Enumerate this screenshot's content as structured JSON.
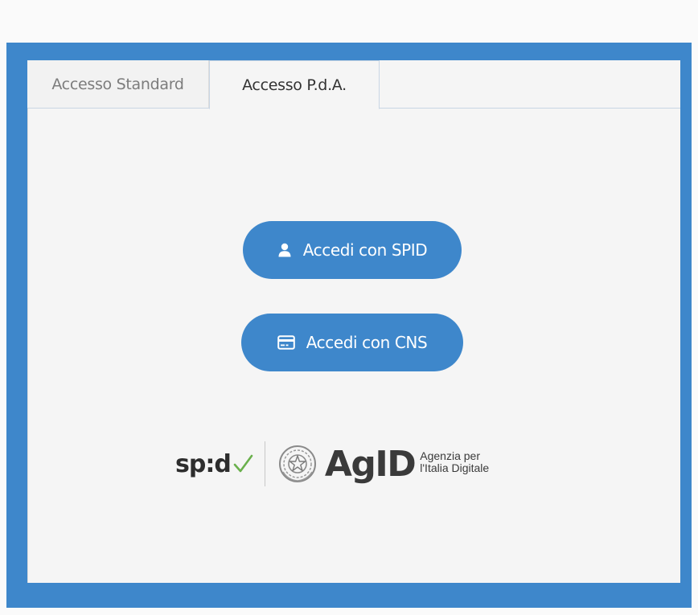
{
  "tabs": [
    {
      "label": "Accesso Standard",
      "active": false
    },
    {
      "label": "Accesso P.d.A.",
      "active": true
    }
  ],
  "buttons": {
    "spid_label": "Accedi con SPID",
    "cns_label": "Accedi con CNS"
  },
  "logos": {
    "spid": "sp:d",
    "agid": "AgID",
    "agid_sub_line1": "Agenzia per",
    "agid_sub_line2": "l'Italia Digitale"
  },
  "colors": {
    "accent": "#3e87cb",
    "frame": "#3e87cb",
    "panel": "#f5f5f5",
    "spid_check": "#6ab04c"
  },
  "icons": {
    "spid_button": "user-icon",
    "cns_button": "card-icon",
    "agid_emblem": "italian-emblem-icon"
  }
}
